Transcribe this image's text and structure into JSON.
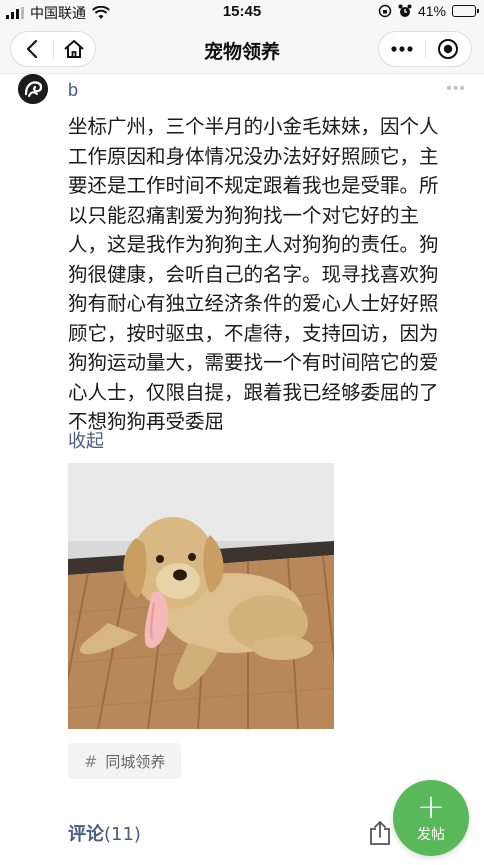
{
  "status_bar": {
    "carrier": "中国联通",
    "time": "15:45",
    "battery": "41%",
    "battery_level": 0.41
  },
  "nav": {
    "title": "宠物领养"
  },
  "post": {
    "username": "b",
    "content_lines": [
      "坐标广州，三个半月的小金毛妹妹，因个人",
      "工作原因和身体情况没办法好好照顾它，主",
      "要还是工作时间不规定跟着我也是受罪。所",
      "以只能忍痛割爱为狗狗找一个对它好的主",
      "人，这是我作为狗狗主人对狗狗的责任。狗",
      "狗很健康，会听自己的名字。现寻找喜欢狗",
      "狗有耐心有独立经济条件的爱心人士好好照",
      "顾它，按时驱虫，不虐待，支持回访，因为",
      "狗狗运动量大，需要找一个有时间陪它的爱",
      "心人士，仅限自提，跟着我已经够委屈的了",
      "不想狗狗再受委屈"
    ],
    "collapse_label": "收起",
    "tag_hash": "#",
    "tag_label": "同城领养",
    "comments_label": "评论",
    "comments_count": "(11)"
  },
  "fab": {
    "plus": "+",
    "label": "发帖"
  },
  "colors": {
    "link": "#4a5d80",
    "fab": "#59b85a"
  },
  "icons": [
    "signal-icon",
    "wifi-icon",
    "lock-rotation-icon",
    "alarm-icon",
    "battery-icon",
    "back-icon",
    "home-icon",
    "more-icon",
    "target-icon",
    "share-icon"
  ]
}
